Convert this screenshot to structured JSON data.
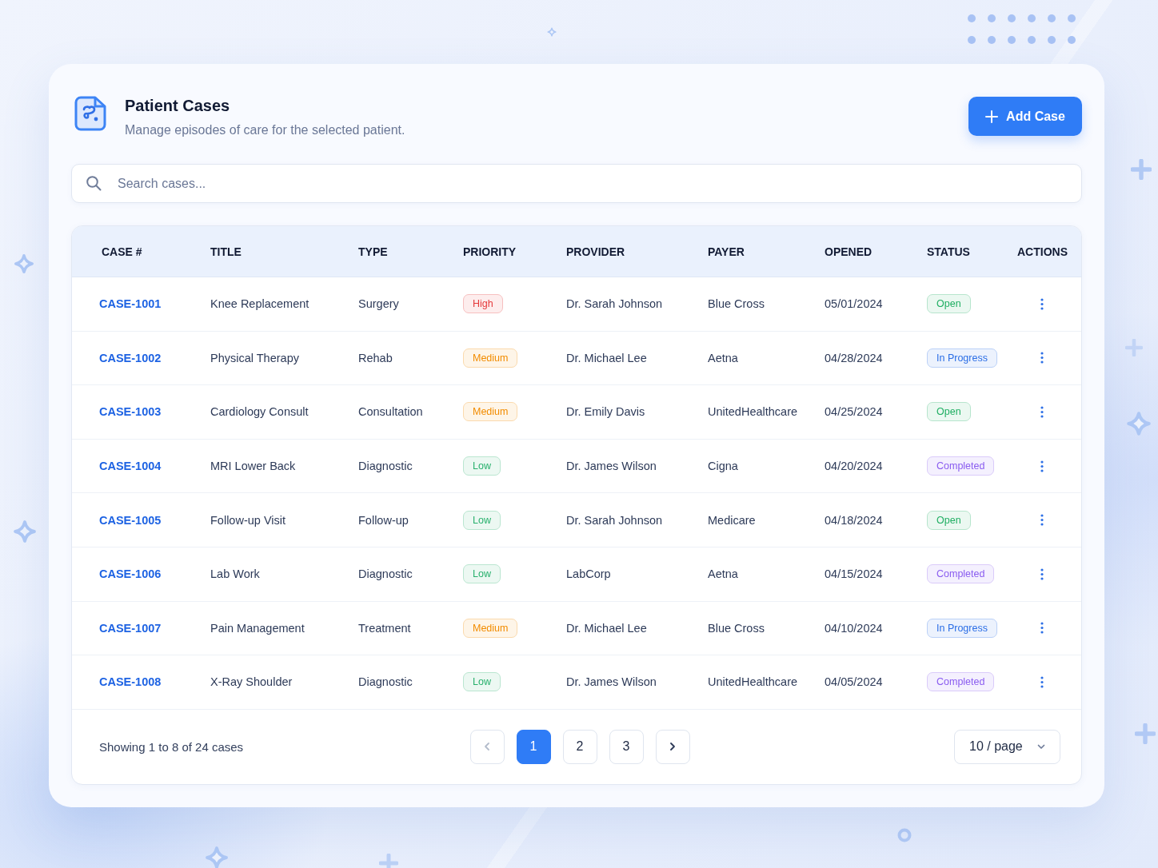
{
  "header": {
    "title": "Patient Cases",
    "subtitle": "Manage episodes of care for the selected patient.",
    "add_button": "Add Case"
  },
  "search": {
    "placeholder": "Search cases..."
  },
  "table": {
    "columns": [
      "CASE #",
      "TITLE",
      "TYPE",
      "PRIORITY",
      "PROVIDER",
      "PAYER",
      "OPENED",
      "STATUS",
      "ACTIONS"
    ],
    "rows": [
      {
        "case_id": "CASE-1001",
        "title": "Knee Replacement",
        "type": "Surgery",
        "priority": {
          "label": "High",
          "color": "#e5393b"
        },
        "provider": "Dr. Sarah Johnson",
        "payer": "Blue Cross",
        "opened": "05/01/2024",
        "status": {
          "label": "Open",
          "color": "#1fae62"
        }
      },
      {
        "case_id": "CASE-1002",
        "title": "Physical Therapy",
        "type": "Rehab",
        "priority": {
          "label": "Medium",
          "color": "#f28c00"
        },
        "provider": "Dr. Michael Lee",
        "payer": "Aetna",
        "opened": "04/28/2024",
        "status": {
          "label": "In Progress",
          "color": "#2c6fe6"
        }
      },
      {
        "case_id": "CASE-1003",
        "title": "Cardiology Consult",
        "type": "Consultation",
        "priority": {
          "label": "Medium",
          "color": "#f28c00"
        },
        "provider": "Dr. Emily Davis",
        "payer": "UnitedHealthcare",
        "opened": "04/25/2024",
        "status": {
          "label": "Open",
          "color": "#1fae62"
        }
      },
      {
        "case_id": "CASE-1004",
        "title": "MRI Lower Back",
        "type": "Diagnostic",
        "priority": {
          "label": "Low",
          "color": "#27b06c"
        },
        "provider": "Dr. James Wilson",
        "payer": "Cigna",
        "opened": "04/20/2024",
        "status": {
          "label": "Completed",
          "color": "#8a5cf0"
        }
      },
      {
        "case_id": "CASE-1005",
        "title": "Follow-up Visit",
        "type": "Follow-up",
        "priority": {
          "label": "Low",
          "color": "#27b06c"
        },
        "provider": "Dr. Sarah Johnson",
        "payer": "Medicare",
        "opened": "04/18/2024",
        "status": {
          "label": "Open",
          "color": "#1fae62"
        }
      },
      {
        "case_id": "CASE-1006",
        "title": "Lab Work",
        "type": "Diagnostic",
        "priority": {
          "label": "Low",
          "color": "#27b06c"
        },
        "provider": "LabCorp",
        "payer": "Aetna",
        "opened": "04/15/2024",
        "status": {
          "label": "Completed",
          "color": "#8a5cf0"
        }
      },
      {
        "case_id": "CASE-1007",
        "title": "Pain Management",
        "type": "Treatment",
        "priority": {
          "label": "Medium",
          "color": "#f28c00"
        },
        "provider": "Dr. Michael Lee",
        "payer": "Blue Cross",
        "opened": "04/10/2024",
        "status": {
          "label": "In Progress",
          "color": "#2c6fe6"
        }
      },
      {
        "case_id": "CASE-1008",
        "title": "X-Ray Shoulder",
        "type": "Diagnostic",
        "priority": {
          "label": "Low",
          "color": "#27b06c"
        },
        "provider": "Dr. James Wilson",
        "payer": "UnitedHealthcare",
        "opened": "04/05/2024",
        "status": {
          "label": "Completed",
          "color": "#8a5cf0"
        }
      }
    ]
  },
  "pagination": {
    "summary": "Showing 1 to 8 of 24 cases",
    "previous": {
      "disabled": true
    },
    "pages": [
      {
        "label": "1",
        "selected": true
      },
      {
        "label": "2",
        "selected": false
      },
      {
        "label": "3",
        "selected": false
      }
    ],
    "next": {
      "disabled": false
    },
    "page_size": "10 / page"
  }
}
